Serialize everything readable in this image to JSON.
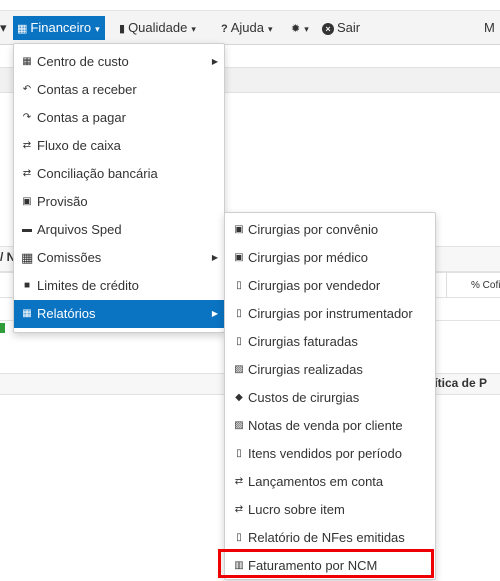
{
  "navbar": {
    "left_caret": "▾",
    "items": [
      {
        "icon": "grid-icon",
        "label": "Financeiro",
        "caret": "▾"
      },
      {
        "icon": "doc-icon",
        "label": "Qualidade",
        "caret": "▾"
      },
      {
        "icon": "question-icon",
        "label": "Ajuda",
        "caret": "▾"
      },
      {
        "icon": "gear-icon",
        "label": "",
        "caret": "▾"
      },
      {
        "icon": "close-circle-icon",
        "label": "Sair",
        "caret": ""
      }
    ],
    "right_label": "M"
  },
  "background": {
    "left_label": "/ N",
    "col_header": "% Cofi",
    "right_label": "lítica de P"
  },
  "financeiro_menu": {
    "items": [
      {
        "icon": "grid-icon",
        "label": "Centro de custo",
        "submenu": true
      },
      {
        "icon": "undo-icon",
        "label": "Contas a receber",
        "submenu": false
      },
      {
        "icon": "redo-icon",
        "label": "Contas a pagar",
        "submenu": false
      },
      {
        "icon": "exchange-icon",
        "label": "Fluxo de caixa",
        "submenu": false
      },
      {
        "icon": "exchange-icon",
        "label": "Conciliação bancária",
        "submenu": false
      },
      {
        "icon": "briefcase-icon",
        "label": "Provisão",
        "submenu": false
      },
      {
        "icon": "folder-icon",
        "label": "Arquivos Sped",
        "submenu": false
      },
      {
        "icon": "table-icon",
        "label": "Comissões",
        "submenu": true
      },
      {
        "icon": "lock-icon",
        "label": "Limites de crédito",
        "submenu": false
      },
      {
        "icon": "grid-icon",
        "label": "Relatórios",
        "submenu": true,
        "active": true
      }
    ]
  },
  "relatorios_menu": {
    "items": [
      {
        "icon": "briefcase-icon",
        "label": "Cirurgias por convênio"
      },
      {
        "icon": "briefcase-icon",
        "label": "Cirurgias por médico"
      },
      {
        "icon": "clipboard-icon",
        "label": "Cirurgias por vendedor"
      },
      {
        "icon": "clipboard-icon",
        "label": "Cirurgias por instrumentador"
      },
      {
        "icon": "clipboard-icon",
        "label": "Cirurgias faturadas"
      },
      {
        "icon": "image-icon",
        "label": "Cirurgias realizadas"
      },
      {
        "icon": "tag-icon",
        "label": "Custos de cirurgias"
      },
      {
        "icon": "image-icon",
        "label": "Notas de venda por cliente"
      },
      {
        "icon": "clipboard-icon",
        "label": "Itens vendidos por período"
      },
      {
        "icon": "exchange-icon",
        "label": "Lançamentos em conta"
      },
      {
        "icon": "exchange-icon",
        "label": "Lucro sobre item"
      },
      {
        "icon": "clipboard-icon",
        "label": "Relatório de NFes emitidas"
      },
      {
        "icon": "building-icon",
        "label": "Faturamento por NCM",
        "highlighted": true
      }
    ]
  },
  "colors": {
    "accent": "#0a73c2",
    "highlight": "#ee0000",
    "navbar_bg": "#f4f4f4"
  }
}
